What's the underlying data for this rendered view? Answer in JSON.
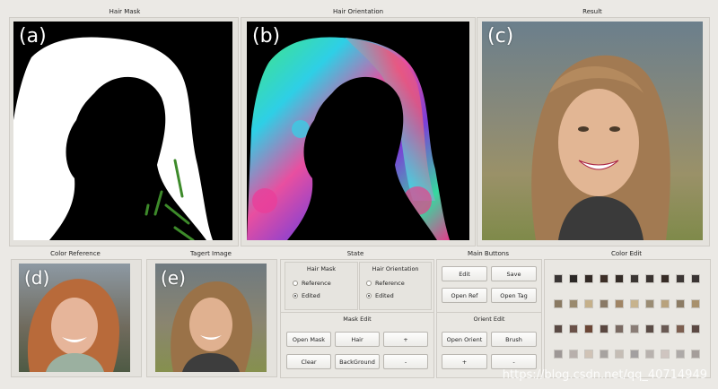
{
  "titles": {
    "hair_mask": "Hair Mask",
    "hair_orientation": "Hair Orientation",
    "result": "Result",
    "color_reference": "Color Reference",
    "target_image": "Tagert Image",
    "state": "State",
    "main_buttons": "Main Buttons",
    "color_edit": "Color Edit"
  },
  "labels": {
    "a": "(a)",
    "b": "(b)",
    "c": "(c)",
    "d": "(d)",
    "e": "(e)"
  },
  "state": {
    "hair_mask": {
      "title": "Hair Mask",
      "opt1": "Reference",
      "opt2": "Edited",
      "selected": "Edited"
    },
    "hair_orientation": {
      "title": "Hair Orientation",
      "opt1": "Reference",
      "opt2": "Edited",
      "selected": "Edited"
    }
  },
  "mask_edit": {
    "title": "Mask Edit",
    "open_mask": "Open Mask",
    "hair": "Hair",
    "plus": "+",
    "clear": "Clear",
    "background": "BackGround",
    "minus": "-"
  },
  "main_buttons": {
    "edit": "Edit",
    "save": "Save",
    "open_ref": "Open Ref",
    "open_tag": "Open Tag"
  },
  "orient_edit": {
    "title": "Orient Edit",
    "open_orient": "Open Orient",
    "brush": "Brush",
    "plus": "+",
    "minus": "-"
  },
  "color_swatches": [
    [
      "#3a3534",
      "#2b2826",
      "#332a25",
      "#3c2e26",
      "#342c27",
      "#3b3633",
      "#3a3330",
      "#372c26",
      "#3d3735",
      "#3a3433"
    ],
    [
      "#8a7a63",
      "#9a8a6e",
      "#c5b08a",
      "#8a7a66",
      "#a08565",
      "#c7b38d",
      "#9a8c74",
      "#b8a27d",
      "#8c7c65",
      "#a8916d"
    ],
    [
      "#5a4a44",
      "#6a5148",
      "#6b4636",
      "#5a4740",
      "#7a6a62",
      "#8a7d76",
      "#5b4c46",
      "#6a5a54",
      "#7d5f50",
      "#5c4943"
    ],
    [
      "#9e9896",
      "#b8b0ac",
      "#d0c3b6",
      "#a7a3a0",
      "#c5bdb5",
      "#a3a0a0",
      "#b8b2ae",
      "#cfc5c0",
      "#aeaaa8",
      "#a59e9a"
    ]
  ],
  "watermark": "https://blog.csdn.net/qq_40714949"
}
